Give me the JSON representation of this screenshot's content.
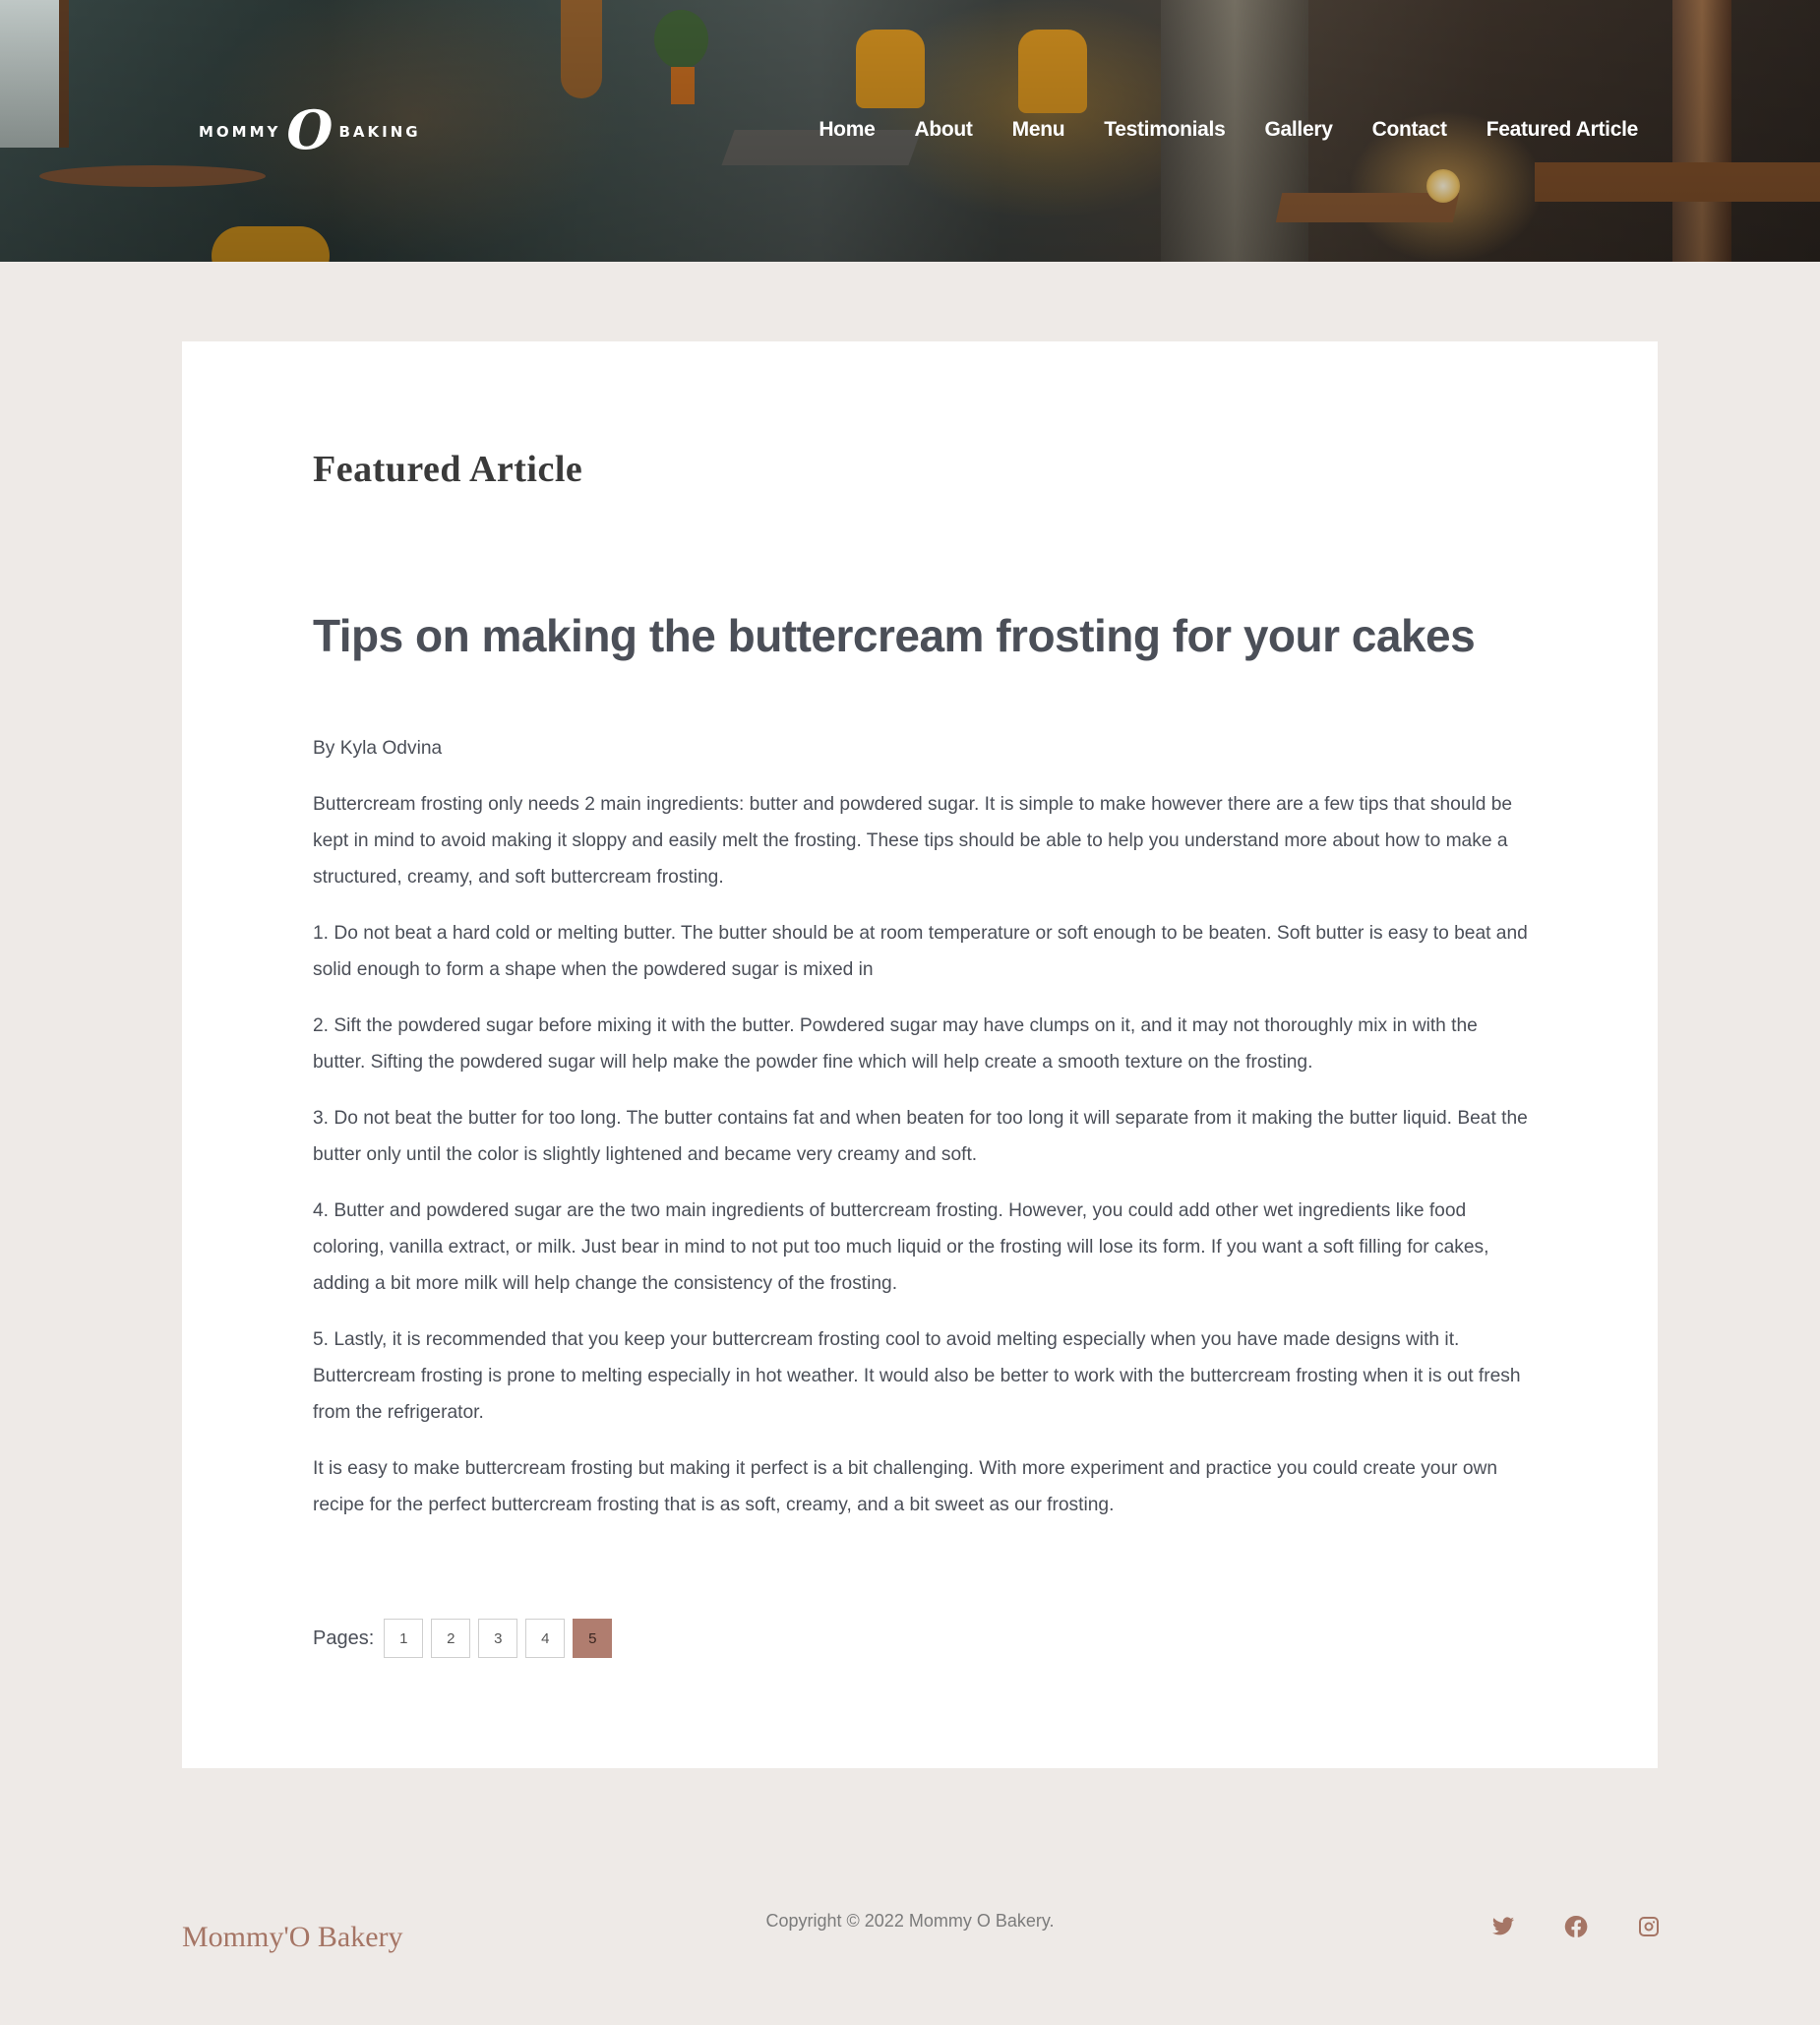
{
  "header": {
    "logo_left": "MOMMY",
    "logo_mark": "O",
    "logo_right": "BAKING",
    "nav": [
      "Home",
      "About",
      "Menu",
      "Testimonials",
      "Gallery",
      "Contact",
      "Featured Article"
    ]
  },
  "main": {
    "section_title": "Featured Article",
    "article_title": "Tips on making the buttercream frosting for your cakes",
    "paragraphs": [
      "By Kyla Odvina",
      "Buttercream frosting only needs 2 main ingredients: butter and powdered sugar. It is simple to make however there are a few tips that should be kept in mind to avoid making it sloppy and easily melt the frosting. These tips should be able to help you understand more about how to make a structured, creamy, and soft buttercream frosting.",
      "1. Do not beat a hard cold or melting butter. The butter should be at room temperature or soft enough to be beaten. Soft butter is easy to beat and solid enough to form a shape when the powdered sugar is mixed in",
      "2. Sift the powdered sugar before mixing it with the butter. Powdered sugar may have clumps on it, and it may not thoroughly mix in with the butter. Sifting the powdered sugar will help make the powder fine which will help create a smooth texture on the frosting.",
      "3. Do not beat the butter for too long. The butter contains fat and when beaten for too long it will separate from it making the butter liquid. Beat the butter only until the color is slightly lightened and became very creamy and soft.",
      "4. Butter and powdered sugar are the two main ingredients of buttercream frosting. However, you could add other wet ingredients like food coloring, vanilla extract, or milk. Just bear in mind to not put too much liquid or the frosting will lose its form. If you want a soft filling for cakes, adding a bit more milk will help change the consistency of the frosting.",
      "5. Lastly, it is recommended that you keep your buttercream frosting cool to avoid melting especially when you have made designs with it. Buttercream frosting is prone to melting especially in hot weather. It would also be better to work with the buttercream frosting when it is out fresh from the refrigerator.",
      "It is easy to make buttercream frosting but making it perfect is a bit challenging. With more experiment and practice you could create your own recipe for the perfect buttercream frosting that is as soft, creamy, and a bit sweet as our frosting."
    ],
    "pagination": {
      "label": "Pages:",
      "pages": [
        "1",
        "2",
        "3",
        "4",
        "5"
      ],
      "current": "5"
    }
  },
  "footer": {
    "brand": "Mommy'O Bakery",
    "copyright": "Copyright © 2022 Mommy O Bakery.",
    "social_icons": [
      "twitter-icon",
      "facebook-icon",
      "instagram-icon"
    ]
  },
  "colors": {
    "page_background": "#eeeae7",
    "accent": "#b07d6f",
    "footer_accent": "#a57565",
    "text": "#4b4f58"
  }
}
